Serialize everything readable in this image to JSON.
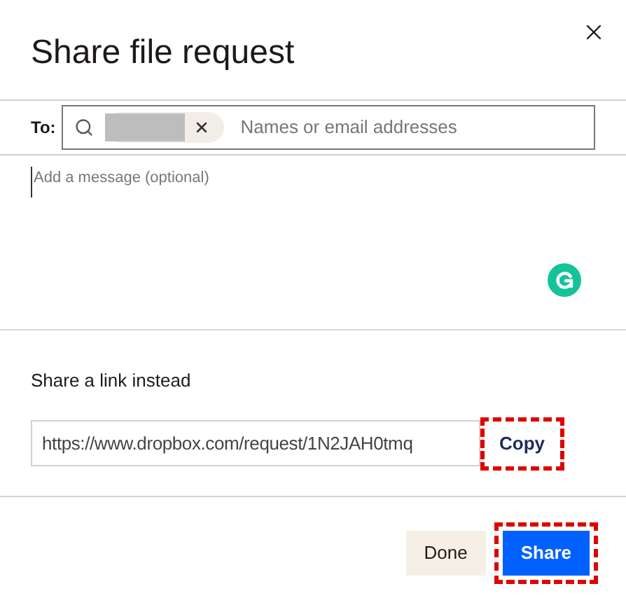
{
  "title": "Share file request",
  "to": {
    "label": "To:",
    "chip_redacted": true,
    "placeholder": "Names or email addresses"
  },
  "message": {
    "placeholder": "Add a message (optional)"
  },
  "link_section": {
    "heading": "Share a link instead",
    "url": "https://www.dropbox.com/request/1N2JAH0tmq",
    "copy": {
      "label": "Copy",
      "highlighted": true
    }
  },
  "buttons": [
    {
      "label": "Done",
      "kind": "secondary"
    },
    {
      "label": "Share",
      "kind": "primary",
      "highlighted": true
    }
  ]
}
